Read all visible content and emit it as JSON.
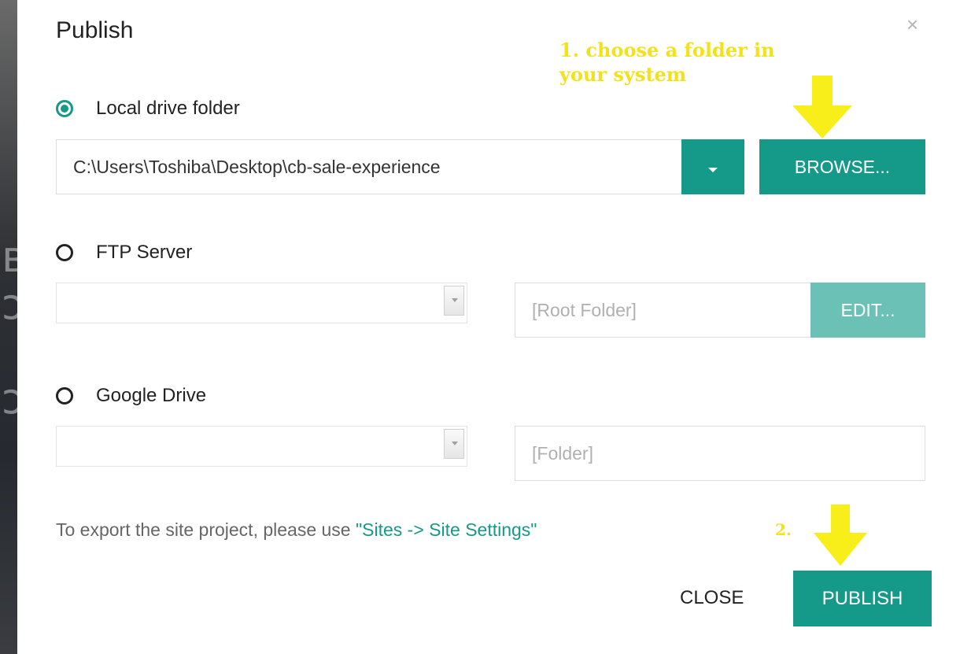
{
  "dialog": {
    "title": "Publish",
    "close_icon": "×"
  },
  "local": {
    "label": "Local drive folder",
    "selected": true,
    "path_value": "C:\\Users\\Toshiba\\Desktop\\cb-sale-experience",
    "browse_label": "BROWSE..."
  },
  "ftp": {
    "label": "FTP Server",
    "selected": false,
    "server_value": "",
    "root_placeholder": "[Root Folder]",
    "edit_label": "EDIT..."
  },
  "gdrive": {
    "label": "Google Drive",
    "selected": false,
    "account_value": "",
    "folder_placeholder": "[Folder]"
  },
  "note": {
    "text": "To export the site project, please use ",
    "link": "\"Sites -> Site Settings\""
  },
  "footer": {
    "close_label": "CLOSE",
    "publish_label": "PUBLISH"
  },
  "annotations": {
    "step1_line1": "1. choose a folder in",
    "step1_line2": "your system",
    "step2": "2."
  },
  "colors": {
    "accent": "#159a8a",
    "accent_disabled": "#6cc1b7",
    "annotation": "#f3e21a"
  }
}
